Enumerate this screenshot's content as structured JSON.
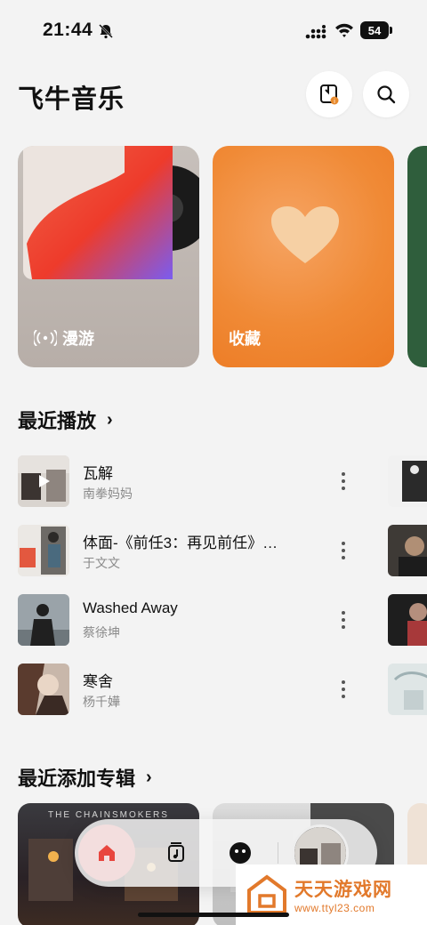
{
  "status_bar": {
    "time": "21:44",
    "battery": "54"
  },
  "header": {
    "title": "飞牛音乐"
  },
  "hero": {
    "roam_label": "漫游",
    "fav_label": "收藏"
  },
  "recent": {
    "title": "最近播放",
    "songs": [
      {
        "title": "瓦解",
        "artist": "南拳妈妈"
      },
      {
        "title": "体面-《前任3：再见前任》…",
        "artist": "于文文"
      },
      {
        "title": "Washed Away",
        "artist": "蔡徐坤"
      },
      {
        "title": "寒舍",
        "artist": "杨千嬅"
      }
    ]
  },
  "albums": {
    "title": "最近添加专辑",
    "items": [
      {
        "label": "THE CHAINSMOKERS"
      }
    ]
  },
  "watermark": {
    "name": "天天游戏网",
    "url": "www.ttyl23.com"
  },
  "colors": {
    "accent": "#e8463e",
    "orange": "#f08a36",
    "green": "#2f5e3c"
  }
}
